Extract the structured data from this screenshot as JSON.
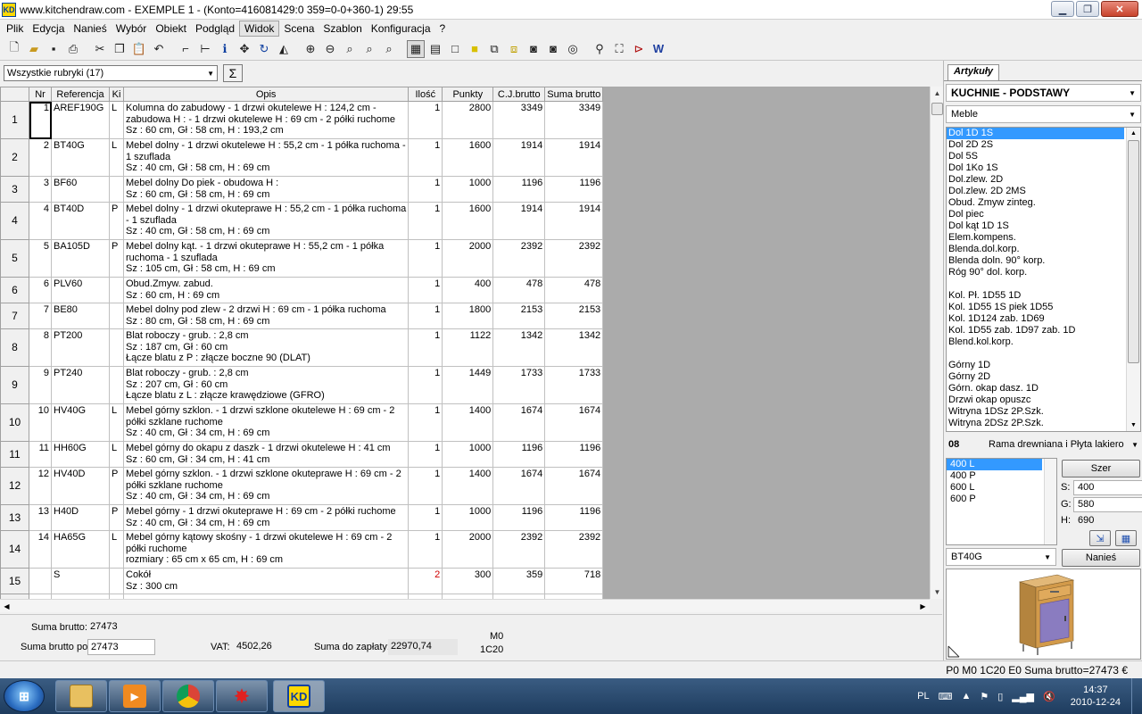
{
  "window": {
    "app_icon": "KD",
    "title": "www.kitchendraw.com - EXEMPLE 1 - (Konto=416081429:0 359=0-0+360-1) 29:55"
  },
  "menu": [
    "Plik",
    "Edycja",
    "Nanieś",
    "Wybór",
    "Obiekt",
    "Podgląd",
    "Widok",
    "Scena",
    "Szablon",
    "Konfiguracja",
    "?"
  ],
  "toolbar_icons": [
    "new-file-icon",
    "open-folder-icon",
    "save-icon",
    "print-icon",
    "cut-icon",
    "copy-icon",
    "paste-icon",
    "undo-icon",
    "place-icon",
    "dimension-icon",
    "info-icon",
    "move-icon",
    "rotate-icon",
    "perspective-icon",
    "zoom-in-icon",
    "zoom-out-icon",
    "zoom-window-icon",
    "zoom-all-icon",
    "zoom-prev-icon",
    "view-plan-icon",
    "view-elevation-icon",
    "view-rect-icon",
    "view-fill-icon",
    "view-3d-icon",
    "view-3d-solid-icon",
    "camera-icon",
    "camera-alt-icon",
    "render-icon",
    "light-icon",
    "shadow-icon",
    "route-icon",
    "web-icon"
  ],
  "filter": {
    "selected": "Wszystkie rubryki (17)",
    "sum_symbol": "Σ"
  },
  "grid": {
    "columns": [
      "Nr",
      "Referencja",
      "Ki",
      "Opis",
      "Ilość",
      "Punkty",
      "C.J.brutto",
      "Suma brutto"
    ],
    "rows": [
      {
        "row": "1",
        "nr": "1",
        "ref": "AREF190G",
        "ki": "L",
        "desc": [
          "Kolumna do zabudowy  - 1 drzwi okutelewe H : 124,2 cm -",
          "zabudowa H :  - 1 drzwi okutelewe H : 69 cm - 2 półki ruchome",
          "Sz : 60 cm, Gł : 58 cm, H : 193,2 cm"
        ],
        "qty": "1",
        "pts": "2800",
        "unit": "3349",
        "sum": "3349",
        "red": false
      },
      {
        "row": "2",
        "nr": "2",
        "ref": "BT40G",
        "ki": "L",
        "desc": [
          "Mebel dolny  - 1 drzwi okutelewe H : 55,2 cm - 1 półka ruchoma -",
          "1 szuflada",
          "Sz : 40 cm, Gł : 58 cm, H : 69 cm"
        ],
        "qty": "1",
        "pts": "1600",
        "unit": "1914",
        "sum": "1914",
        "red": false
      },
      {
        "row": "3",
        "nr": "3",
        "ref": "BF60",
        "ki": "",
        "desc": [
          "Mebel dolny  Do piek - obudowa H :",
          "Sz : 60 cm, Gł : 58 cm, H : 69 cm"
        ],
        "qty": "1",
        "pts": "1000",
        "unit": "1196",
        "sum": "1196",
        "red": false
      },
      {
        "row": "4",
        "nr": "4",
        "ref": "BT40D",
        "ki": "P",
        "desc": [
          "Mebel dolny  - 1 drzwi okuteprawe H : 55,2 cm - 1 półka ruchoma",
          "- 1 szuflada",
          "Sz : 40 cm, Gł : 58 cm, H : 69 cm"
        ],
        "qty": "1",
        "pts": "1600",
        "unit": "1914",
        "sum": "1914",
        "red": false
      },
      {
        "row": "5",
        "nr": "5",
        "ref": "BA105D",
        "ki": "P",
        "desc": [
          "Mebel dolny  kąt. - 1 drzwi okuteprawe H : 55,2 cm - 1 półka",
          "ruchoma - 1 szuflada",
          "Sz : 105 cm, Gł : 58 cm, H : 69 cm"
        ],
        "qty": "1",
        "pts": "2000",
        "unit": "2392",
        "sum": "2392",
        "red": false
      },
      {
        "row": "6",
        "nr": "6",
        "ref": "PLV60",
        "ki": "",
        "desc": [
          "Obud.Zmyw. zabud.",
          "Sz : 60 cm, H : 69 cm"
        ],
        "qty": "1",
        "pts": "400",
        "unit": "478",
        "sum": "478",
        "red": false
      },
      {
        "row": "7",
        "nr": "7",
        "ref": "BE80",
        "ki": "",
        "desc": [
          "Mebel dolny pod zlew - 2 drzwi H : 69 cm - 1 półka ruchoma",
          "Sz : 80 cm, Gł : 58 cm, H : 69 cm"
        ],
        "qty": "1",
        "pts": "1800",
        "unit": "2153",
        "sum": "2153",
        "red": false
      },
      {
        "row": "8",
        "nr": "8",
        "ref": "PT200",
        "ki": "",
        "desc": [
          "Blat roboczy - grub. : 2,8 cm",
          "Sz : 187 cm, Gł : 60 cm",
          "Łącze blatu z P : złącze boczne 90 (DLAT)"
        ],
        "qty": "1",
        "pts": "1122",
        "unit": "1342",
        "sum": "1342",
        "red": false
      },
      {
        "row": "9",
        "nr": "9",
        "ref": "PT240",
        "ki": "",
        "desc": [
          "Blat roboczy - grub. : 2,8 cm",
          "Sz : 207 cm, Gł : 60 cm",
          "Łącze blatu z L : złącze krawędziowe (GFRO)"
        ],
        "qty": "1",
        "pts": "1449",
        "unit": "1733",
        "sum": "1733",
        "red": false
      },
      {
        "row": "10",
        "nr": "10",
        "ref": "HV40G",
        "ki": "L",
        "desc": [
          "Mebel górny  szklon. - 1 drzwi szklone okutelewe H : 69 cm - 2",
          "półki szklane ruchome",
          "Sz : 40 cm, Gł : 34 cm, H : 69 cm"
        ],
        "qty": "1",
        "pts": "1400",
        "unit": "1674",
        "sum": "1674",
        "red": false
      },
      {
        "row": "11",
        "nr": "11",
        "ref": "HH60G",
        "ki": "L",
        "desc": [
          "Mebel górny  do okapu z daszk - 1 drzwi okutelewe H : 41 cm",
          "Sz : 60 cm, Gł : 34 cm, H : 41 cm"
        ],
        "qty": "1",
        "pts": "1000",
        "unit": "1196",
        "sum": "1196",
        "red": false
      },
      {
        "row": "12",
        "nr": "12",
        "ref": "HV40D",
        "ki": "P",
        "desc": [
          "Mebel górny  szklon. - 1 drzwi szklone okuteprawe H : 69 cm - 2",
          "półki szklane ruchome",
          "Sz : 40 cm, Gł : 34 cm, H : 69 cm"
        ],
        "qty": "1",
        "pts": "1400",
        "unit": "1674",
        "sum": "1674",
        "red": false
      },
      {
        "row": "13",
        "nr": "13",
        "ref": "H40D",
        "ki": "P",
        "desc": [
          "Mebel górny - 1 drzwi okuteprawe H : 69 cm - 2 półki ruchome",
          "Sz : 40 cm, Gł : 34 cm, H : 69 cm"
        ],
        "qty": "1",
        "pts": "1000",
        "unit": "1196",
        "sum": "1196",
        "red": false
      },
      {
        "row": "14",
        "nr": "14",
        "ref": "HA65G",
        "ki": "L",
        "desc": [
          "Mebel górny  kątowy skośny - 1 drzwi okutelewe H : 69 cm - 2",
          "półki ruchome",
          "rozmiary : 65 cm x 65 cm, H : 69 cm"
        ],
        "qty": "1",
        "pts": "2000",
        "unit": "2392",
        "sum": "2392",
        "red": false
      },
      {
        "row": "15",
        "nr": "",
        "ref": "S",
        "ki": "",
        "desc": [
          "Cokół",
          "Sz : 300 cm"
        ],
        "qty": "2",
        "pts": "300",
        "unit": "359",
        "sum": "718",
        "red": true
      }
    ]
  },
  "summary": {
    "suma_brutto_label": "Suma brutto:",
    "suma_brutto_value": "27473",
    "suma_brutto_po_label": "Suma brutto po",
    "suma_brutto_po_value": "27473",
    "vat_label": "VAT:",
    "vat_value": "4502,26",
    "do_zaplaty_label": "Suma do zapłaty:",
    "do_zaplaty_value": "22970,74",
    "code1": "M0",
    "code2": "1C20"
  },
  "right_panel": {
    "tab": "Artykuły",
    "catalog": "KUCHNIE - PODSTAWY",
    "family": "Meble",
    "items": [
      "Dol 1D 1S",
      "Dol 2D 2S",
      "Dol 5S",
      "Dol 1Ko 1S",
      "Dol.zlew. 2D",
      "Dol.zlew. 2D 2MS",
      "Obud. Zmyw zinteg.",
      "Dol piec",
      "Dol kąt 1D 1S",
      "Elem.kompens.",
      "Blenda.dol.korp.",
      "Blenda  doln. 90° korp.",
      "Róg 90° dol. korp.",
      "",
      "Kol. Pł. 1D55 1D",
      "Kol. 1D55 1S piek 1D55",
      "Kol. 1D124 zab. 1D69",
      "Kol. 1D55 zab. 1D97 zab. 1D",
      "Blend.kol.korp.",
      "",
      "Górny 1D",
      "Górny 2D",
      "Górn. okap dasz. 1D",
      "Drzwi okap opuszc",
      "Witryna 1DSz 2P.Szk.",
      "Witryna 2DSz 2P.Szk."
    ],
    "style_code": "08",
    "style_name": "Rama drewniana i Płyta lakiero",
    "sizes": [
      "400 L",
      "400  P",
      "600 L",
      "600  P"
    ],
    "szer_button": "Szer",
    "s_label": "S:",
    "s_value": "400",
    "g_label": "G:",
    "g_value": "580",
    "h_label": "H:",
    "h_value": "690",
    "reference": "BT40G",
    "nanies_button": "Nanieś"
  },
  "status": {
    "text": "P0 M0 1C20 E0 Suma brutto=27473 €"
  },
  "taskbar": {
    "language": "PL",
    "time": "14:37",
    "date": "2010-12-24",
    "apps": [
      "explorer-icon",
      "media-player-icon",
      "chrome-icon",
      "paint-icon",
      "kitchendraw-icon"
    ],
    "kd_label": "KD"
  },
  "colors": {
    "selection": "#3399ff",
    "red_qty": "#d00000",
    "grid_bg": "#ababab"
  }
}
